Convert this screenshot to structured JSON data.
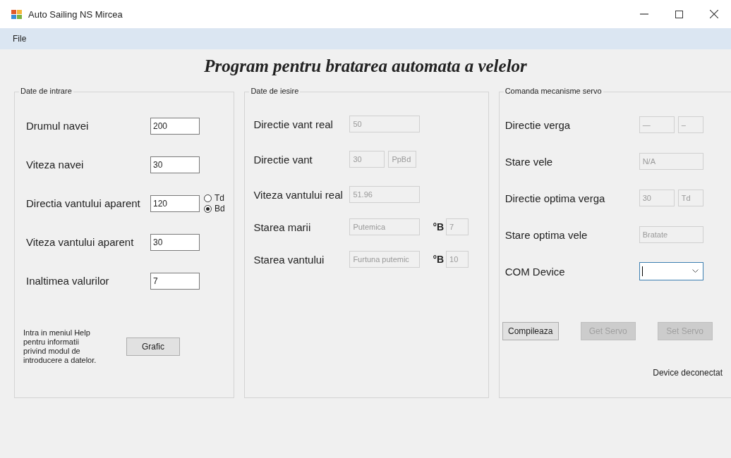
{
  "window": {
    "title": "Auto Sailing NS Mircea"
  },
  "menu": [
    "File"
  ],
  "heading": "Program pentru bratarea automata a velelor",
  "input_group": {
    "title": "Date de intrare",
    "fields": [
      {
        "label": "Drumul navei",
        "value": "200"
      },
      {
        "label": "Viteza navei",
        "value": "30"
      },
      {
        "label": "Directia vantului aparent",
        "value": "120",
        "options": [
          {
            "label": "Td",
            "selected": false
          },
          {
            "label": "Bd",
            "selected": true
          }
        ]
      },
      {
        "label": "Viteza vantului aparent",
        "value": "30"
      },
      {
        "label": "Inaltimea valurilor",
        "value": "7"
      }
    ],
    "help_text": "Intra in meniul Help pentru informatii privind modul de introducere a datelor.",
    "button": "Grafic"
  },
  "output_group": {
    "title": "Date de iesire",
    "rows": [
      {
        "label": "Directie vant real",
        "values": [
          "50"
        ]
      },
      {
        "label": "Directie vant",
        "values": [
          "30",
          "PpBd"
        ]
      },
      {
        "label": "Viteza vantului real",
        "values": [
          "51.96"
        ]
      },
      {
        "label": "Starea marii",
        "values": [
          "Putemica"
        ],
        "scale": {
          "unit": "°B",
          "value": "7"
        }
      },
      {
        "label": "Starea vantului",
        "values": [
          "Furtuna putemic"
        ],
        "scale": {
          "unit": "°B",
          "value": "10"
        }
      }
    ]
  },
  "servo_group": {
    "title": "Comanda mecanisme servo",
    "rows": [
      {
        "kind": "pair",
        "label": "Directie verga",
        "values": [
          "—",
          "–"
        ]
      },
      {
        "kind": "text",
        "label": "Stare vele",
        "values": [
          "N/A"
        ]
      },
      {
        "kind": "pair",
        "label": "Directie optima verga",
        "values": [
          "30",
          "Td"
        ]
      },
      {
        "kind": "text",
        "label": "Stare optima vele",
        "values": [
          "Bratate"
        ]
      },
      {
        "kind": "combo",
        "label": "COM Device",
        "values": []
      }
    ],
    "buttons": [
      {
        "label": "Compileaza",
        "disabled": false
      },
      {
        "label": "Get Servo",
        "disabled": true
      },
      {
        "label": "Set Servo",
        "disabled": true
      }
    ],
    "status": "Device deconectat"
  }
}
